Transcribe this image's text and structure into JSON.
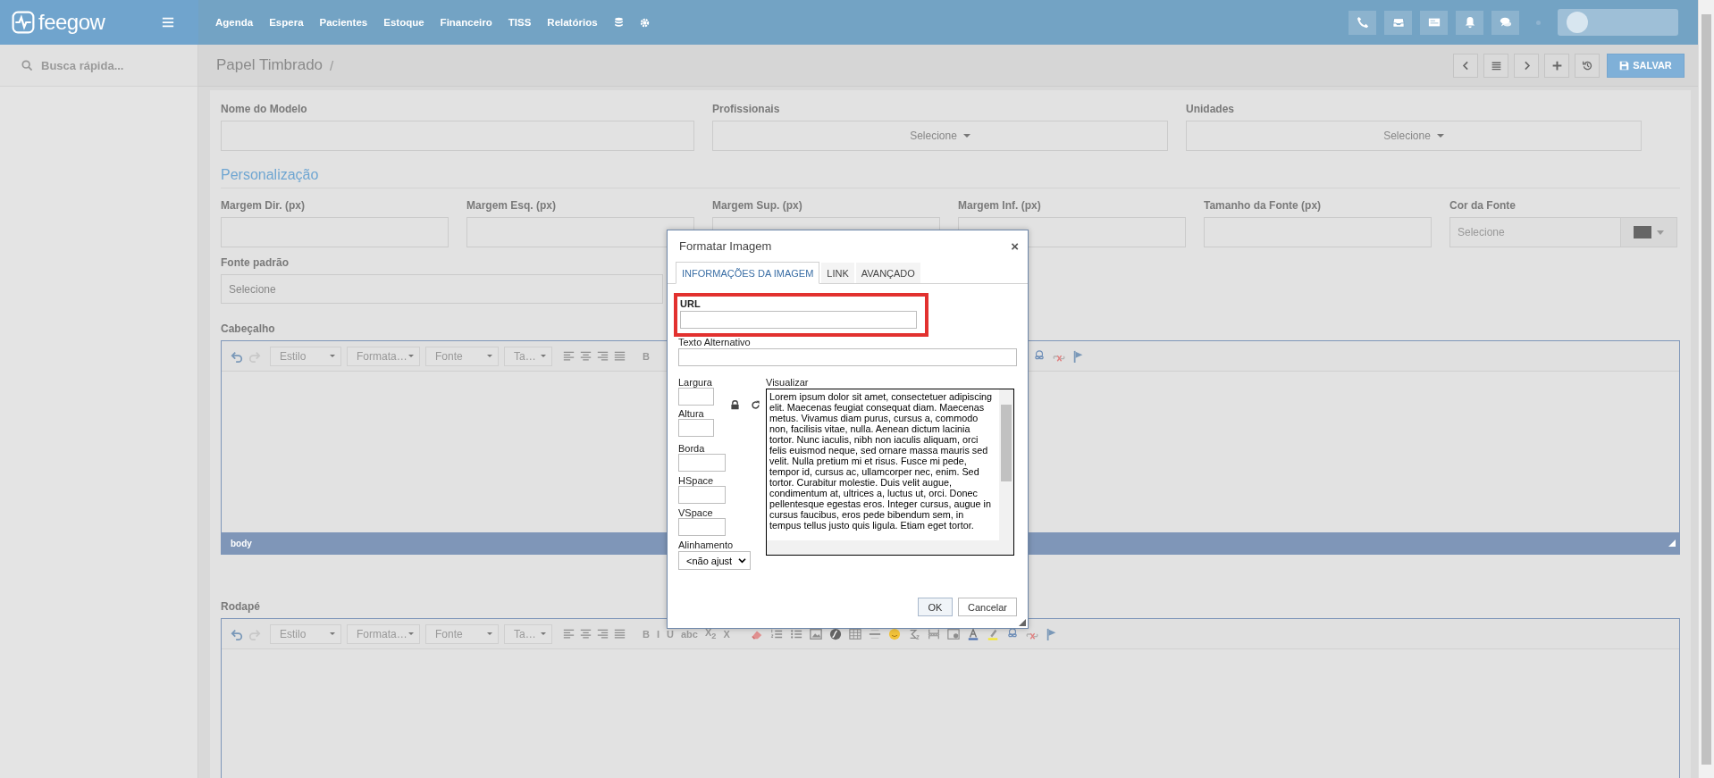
{
  "topbar": {
    "logo": "feegow",
    "nav": [
      "Agenda",
      "Espera",
      "Pacientes",
      "Estoque",
      "Financeiro",
      "TISS",
      "Relatórios"
    ]
  },
  "sidebar": {
    "search": {
      "placeholder": "Busca rápida..."
    }
  },
  "breadcrumb": {
    "title": "Papel Timbrado",
    "separator": "/",
    "save": "SALVAR"
  },
  "form": {
    "row1": [
      {
        "label": "Nome do Modelo",
        "kind": "input"
      },
      {
        "label": "Profissionais",
        "kind": "select",
        "value": "Selecione"
      },
      {
        "label": "Unidades",
        "kind": "select",
        "value": "Selecione"
      }
    ],
    "section": "Personalização",
    "row2": [
      {
        "label": "Margem Dir. (px)",
        "kind": "input"
      },
      {
        "label": "Margem Esq. (px)",
        "kind": "input"
      },
      {
        "label": "Margem Sup. (px)",
        "kind": "input"
      },
      {
        "label": "Margem Inf. (px)",
        "kind": "input"
      },
      {
        "label": "Tamanho da Fonte (px)",
        "kind": "input"
      },
      {
        "label": "Cor da Fonte",
        "kind": "color",
        "placeholder": "Selecione",
        "color": "#666666"
      }
    ],
    "font_default": {
      "label": "Fonte padrão",
      "value": "Selecione"
    }
  },
  "editors": [
    {
      "label": "Cabeçalho",
      "full_toolbar": false,
      "combos": [
        "Estilo",
        "Formata…",
        "Fonte",
        "Ta…"
      ],
      "format_buttons": [
        "B"
      ],
      "path": "body"
    },
    {
      "label": "Rodapé",
      "full_toolbar": true,
      "combos": [
        "Estilo",
        "Formata…",
        "Fonte",
        "Ta…"
      ],
      "format_buttons": [
        "B",
        "I",
        "U",
        "abc",
        "X$_{2}$",
        "X"
      ]
    }
  ],
  "dialog": {
    "title": "Formatar Imagem",
    "close": "×",
    "tabs": [
      {
        "label": "INFORMAÇÕES DA IMAGEM",
        "selected": true
      },
      {
        "label": "LINK",
        "selected": false
      },
      {
        "label": "AVANÇADO",
        "selected": false
      }
    ],
    "url_label": "URL",
    "alt_label": "Texto Alternativo",
    "width_label": "Largura",
    "height_label": "Altura",
    "border_label": "Borda",
    "hspace_label": "HSpace",
    "vspace_label": "VSpace",
    "align_label": "Alinhamento",
    "align_value": "<não ajust",
    "preview_label": "Visualizar",
    "preview_text": "Lorem ipsum dolor sit amet, consectetuer adipiscing elit. Maecenas feugiat consequat diam. Maecenas metus. Vivamus diam purus, cursus a, commodo non, facilisis vitae, nulla. Aenean dictum lacinia tortor. Nunc iaculis, nibh non iaculis aliquam, orci felis euismod neque, sed ornare massa mauris sed velit. Nulla pretium mi et risus. Fusce mi pede, tempor id, cursus ac, ullamcorper nec, enim. Sed tortor. Curabitur molestie. Duis velit augue, condimentum at, ultrices a, luctus ut, orci. Donec pellentesque egestas eros. Integer cursus, augue in cursus faucibus, eros pede bibendum sem, in tempus tellus justo quis ligula. Etiam eget tortor.",
    "buttons": [
      "OK",
      "Cancelar"
    ]
  }
}
